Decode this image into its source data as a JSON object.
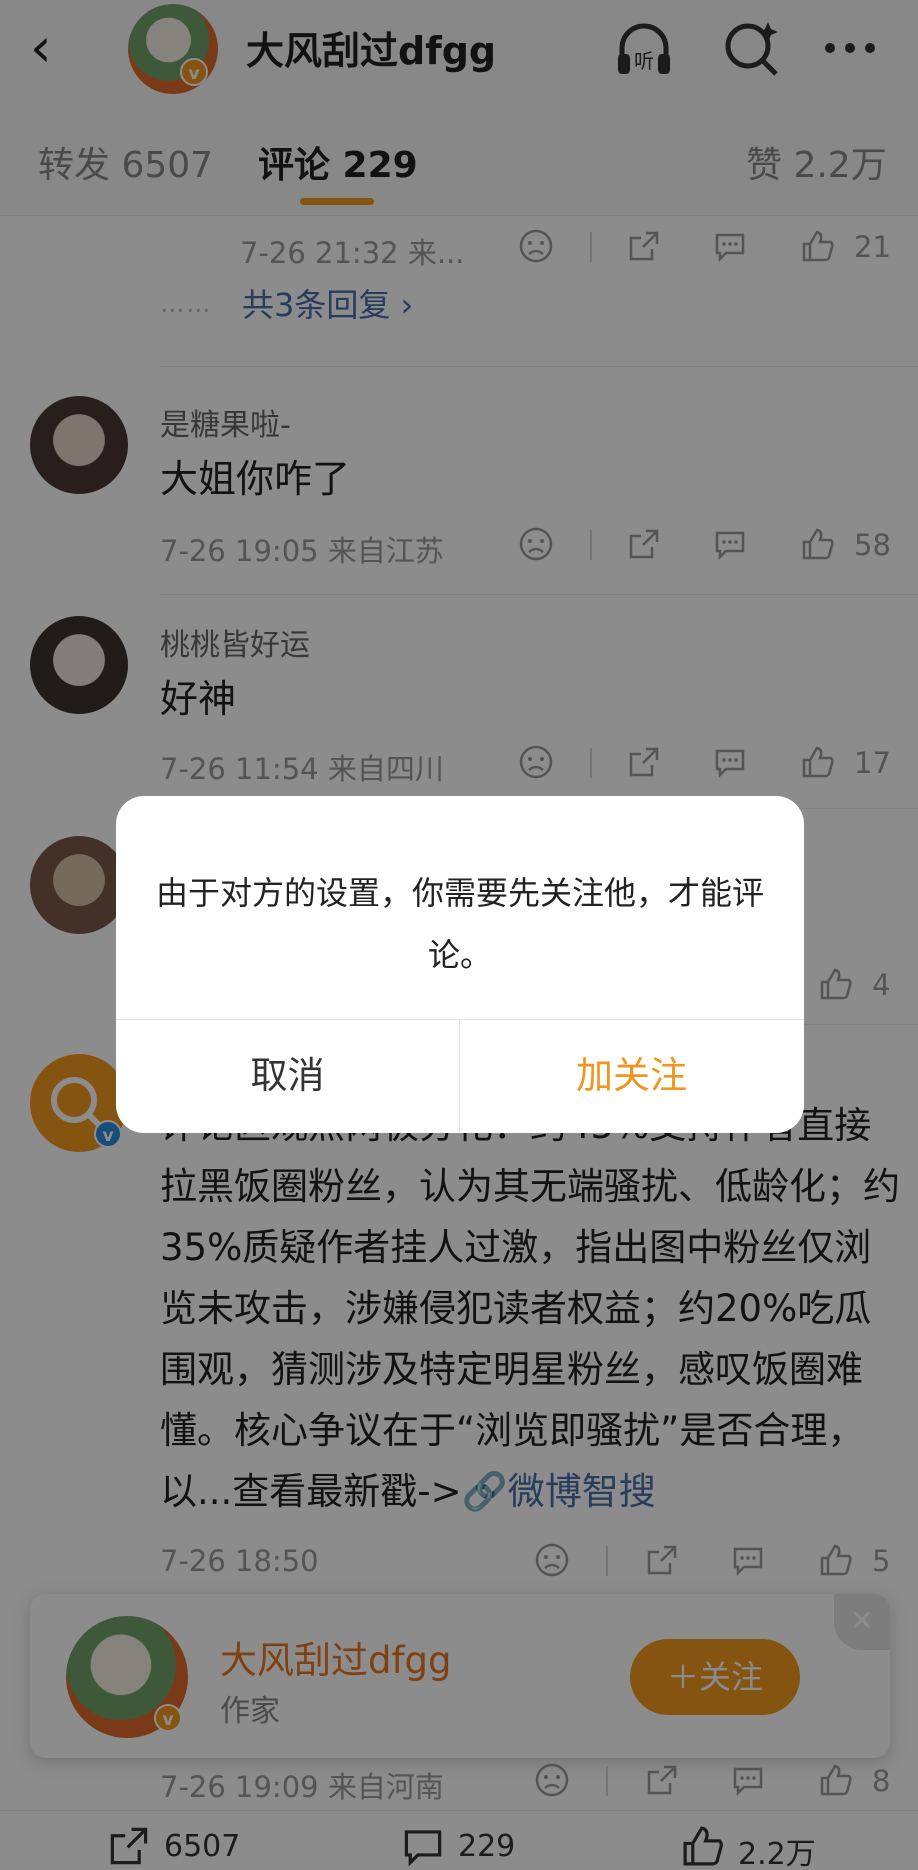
{
  "header": {
    "title": "大风刮过dfgg"
  },
  "tabs": [
    {
      "label": "转发 6507"
    },
    {
      "label": "评论 229"
    },
    {
      "label": "赞 2.2万"
    }
  ],
  "comments": [
    {
      "time": "7-26 21:32 来...",
      "likes": "21",
      "more_replies": "共3条回复 ›"
    },
    {
      "user": "是糖果啦-",
      "text": "大姐你咋了",
      "time": "7-26 19:05 来自江苏",
      "likes": "58"
    },
    {
      "user": "桃桃皆好运",
      "text": "好神",
      "time": "7-26 11:54 来自四川",
      "likes": "17"
    },
    {
      "likes": "4"
    },
    {
      "text": "评论区观点两极分化：约45%支持作者直接拉黑饭圈粉丝，认为其无端骚扰、低龄化；约35%质疑作者挂人过激，指出图中粉丝仅浏览未攻击，涉嫌侵犯读者权益；约20%吃瓜围观，猜测涉及特定明星粉丝，感叹饭圈难懂。核心争议在于“浏览即骚扰”是否合理，以...查看最新戳->",
      "link": "微博智搜",
      "time": "7-26 18:50",
      "likes": "5"
    },
    {
      "time": "7-26 19:09 来自河南",
      "likes": "8"
    }
  ],
  "follow_card": {
    "name": "大风刮过dfgg",
    "role": "作家",
    "button": "＋关注",
    "close": "✕"
  },
  "bottom_bar": {
    "repost": "6507",
    "comment": "229",
    "like": "2.2万"
  },
  "dialog": {
    "message": "由于对方的设置，你需要先关注他，才能评论。",
    "cancel": "取消",
    "confirm": "加关注"
  }
}
